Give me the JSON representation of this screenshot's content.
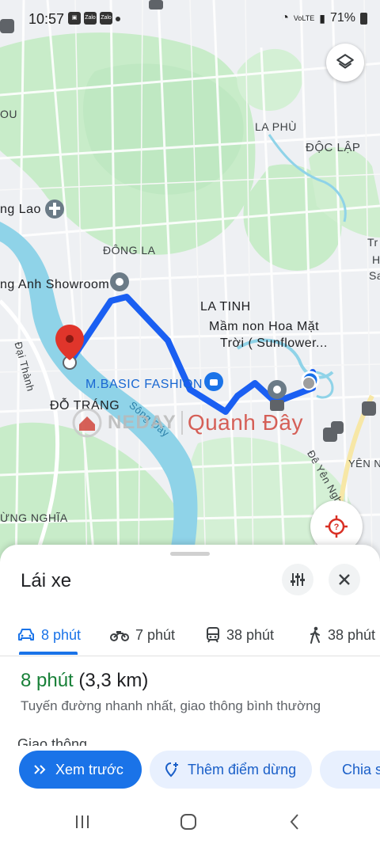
{
  "status_bar": {
    "time": "10:57",
    "app_icons": [
      "Zalo",
      "Zalo"
    ],
    "network": "VoLTE",
    "battery": "71%"
  },
  "map": {
    "labels": {
      "place_ou": "OU",
      "la_phu": "LA PHÙ",
      "doc_lap": "ĐỘC LẬP",
      "ng_lao": "ng Lao",
      "dong_la": "ĐÔNG LA",
      "tr": "Tr",
      "h": "H",
      "sa": "Sa",
      "showroom": "ng Anh Showroom",
      "la_tinh": "LA TINH",
      "mam_non_1": "Mầm non Hoa Mặt",
      "mam_non_2": "Trời ( Sunflower...",
      "dai_thanh": "Đại Thành",
      "mbasic": "M.BASIC FASHION",
      "do_trang": "ĐỖ TRÁNG",
      "song_day": "Sông Đáy",
      "de_yen_nghia": "Đê Yên Nghĩa",
      "yen_n": "YÊN N",
      "ung_nghia": "ỪNG NGHĨA"
    },
    "watermark": {
      "left_text": "NEDAY",
      "right_text": "Quanh Đây"
    },
    "icons": {
      "layers": "layers-icon",
      "locate": "location-target-icon",
      "destination": "red-pin-icon"
    }
  },
  "sheet": {
    "title": "Lái xe",
    "tabs": [
      {
        "icon": "car-icon",
        "label": "8 phút"
      },
      {
        "icon": "motorbike-icon",
        "label": "7 phút"
      },
      {
        "icon": "transit-icon",
        "label": "38 phút"
      },
      {
        "icon": "walk-icon",
        "label": "38 phút"
      }
    ],
    "active_tab": 0,
    "duration": "8 phút",
    "distance": "(3,3 km)",
    "description": "Tuyến đường nhanh nhất, giao thông bình thường",
    "cut_text": "Giao thông",
    "actions": {
      "preview": "Xem trước",
      "add_stop": "Thêm điểm dừng",
      "share": "Chia sẻ"
    }
  },
  "colors": {
    "route": "#1a5ff2",
    "accent": "#1a73e8",
    "green": "#188038",
    "water": "#8fd3e8",
    "park": "#c5ecc8"
  }
}
